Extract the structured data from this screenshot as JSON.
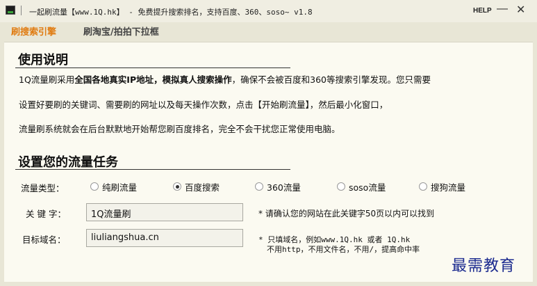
{
  "window": {
    "title": "一起刷流量【www.1Q.hk】 - 免费提升搜索排名，支持百度、360、soso~ v1.8",
    "help_label": "HELP",
    "minimize_label": "—",
    "close_label": "✕",
    "icon": "app-icon"
  },
  "tabs": [
    {
      "label": "刷搜索引擎",
      "active": true
    },
    {
      "label": "刷淘宝/拍拍下拉框",
      "active": false
    }
  ],
  "instructions": {
    "title": "使用说明",
    "line1_pre": "1Q流量刷采用",
    "line1_bold": "全国各地真实IP地址，模拟真人搜索操作",
    "line1_post": "，确保不会被百度和360等搜索引擎发现。您只需要",
    "line2": "设置好要刷的关键词、需要刷的网址以及每天操作次数，点击【开始刷流量】，然后最小化窗口，",
    "line3": "流量刷系统就会在后台默默地开始帮您刷百度排名，完全不会干扰您正常使用电脑。"
  },
  "task": {
    "title": "设置您的流量任务",
    "traffic_type_label": "流量类型：",
    "traffic_types": [
      {
        "label": "纯刷流量",
        "checked": false
      },
      {
        "label": "百度搜索",
        "checked": true
      },
      {
        "label": "360流量",
        "checked": false
      },
      {
        "label": "soso流量",
        "checked": false
      },
      {
        "label": "搜狗流量",
        "checked": false
      }
    ],
    "keyword_label": "关 键 字：",
    "keyword_value": "1Q流量刷",
    "keyword_note": "* 请确认您的网站在此关键字50页以内可以找到",
    "domain_label": "目标域名：",
    "domain_value": "liuliangshua.cn",
    "domain_note_line1": "* 只填域名，例如www.1Q.hk 或者 1Q.hk",
    "domain_note_line2": "不用http，不用文件名，不用/，提高命中率"
  },
  "watermark": "最需教育",
  "colors": {
    "active_tab": "#e07b10",
    "panel_bg": "#fbfaf1",
    "window_bg": "#e8e6d6",
    "watermark": "#1b2a8f"
  }
}
